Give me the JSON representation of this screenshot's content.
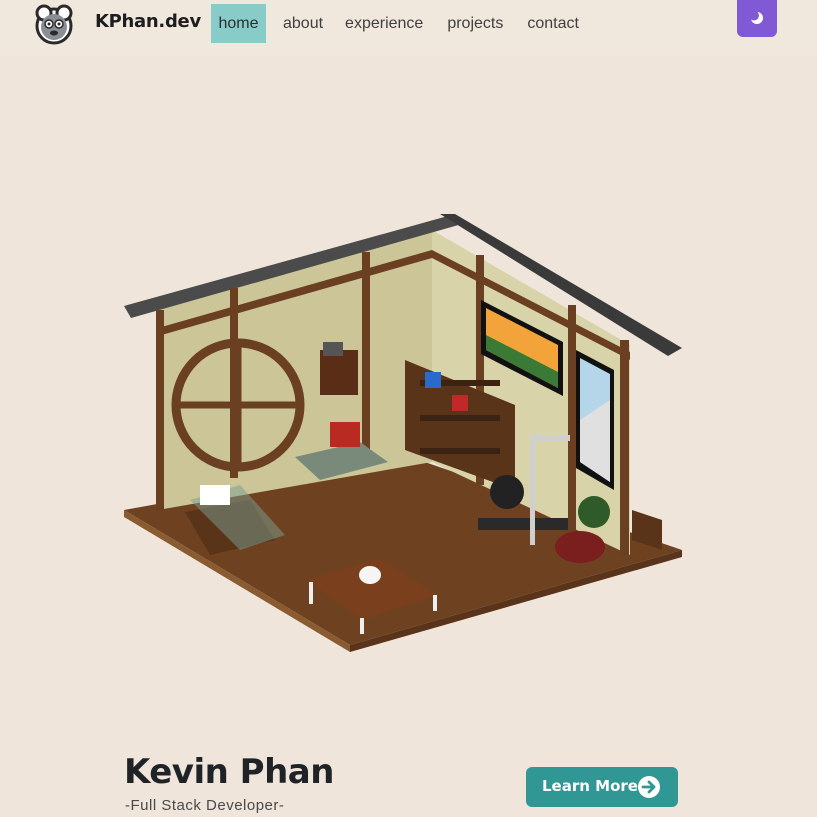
{
  "navbar": {
    "logo_icon": "mouse-avatar-icon",
    "brand": "KPhan.dev",
    "links": [
      {
        "label": "home",
        "active": true
      },
      {
        "label": "about",
        "active": false
      },
      {
        "label": "experience",
        "active": false
      },
      {
        "label": "projects",
        "active": false
      },
      {
        "label": "contact",
        "active": false
      }
    ],
    "theme_toggle_icon": "moon-icon"
  },
  "hero": {
    "scene_image": "voxel-room-illustration",
    "name": "Kevin Phan",
    "subtitle": "-Full Stack Developer-",
    "cta_label": "Learn More",
    "cta_icon": "arrow-right-circle-icon"
  },
  "colors": {
    "page_bg": "#efe5da",
    "nav_bg": "#f1e8dd",
    "active_link_bg": "#88ccca",
    "theme_button": "#805ad5",
    "cta_button": "#319795",
    "text_dark": "#1f2328"
  }
}
